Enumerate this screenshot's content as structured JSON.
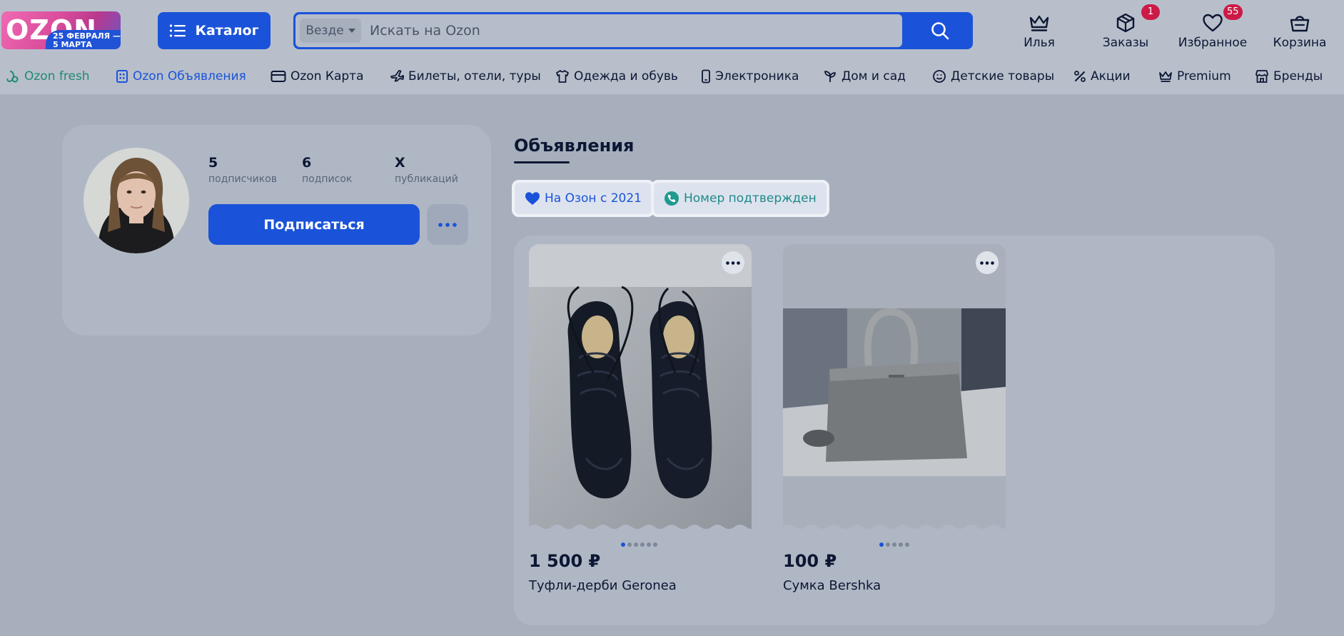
{
  "logo": {
    "word": "OZON",
    "promo": "25 ФЕВРАЛЯ — 5 МАРТА"
  },
  "catalog": {
    "label": "Каталог"
  },
  "search": {
    "scope": "Везде",
    "placeholder": "Искать на Ozon"
  },
  "header_actions": [
    {
      "label": "Илья",
      "icon": "crown-icon"
    },
    {
      "label": "Заказы",
      "icon": "box-icon",
      "badge": "1"
    },
    {
      "label": "Избранное",
      "icon": "heart-icon",
      "badge": "55"
    },
    {
      "label": "Корзина",
      "icon": "basket-icon"
    }
  ],
  "nav": [
    {
      "label": "Ozon fresh",
      "color": "#1f8a70"
    },
    {
      "label": "Ozon Объявления",
      "color": "#1a53d9"
    },
    {
      "label": "Ozon Карта"
    },
    {
      "label": "Билеты, отели, туры"
    },
    {
      "label": "Одежда и обувь"
    },
    {
      "label": "Электроника"
    },
    {
      "label": "Дом и сад"
    },
    {
      "label": "Детские товары"
    },
    {
      "label": "Акции"
    },
    {
      "label": "Premium"
    },
    {
      "label": "Бренды"
    }
  ],
  "profile": {
    "stats": [
      {
        "value": "5",
        "caption": "подписчиков"
      },
      {
        "value": "6",
        "caption": "подписок"
      },
      {
        "value": "X",
        "caption": "публикаций"
      }
    ],
    "subscribe_label": "Подписаться"
  },
  "listings": {
    "title": "Объявления",
    "chips": [
      {
        "label": "На Озон с 2021",
        "color": "#1a53d9"
      },
      {
        "label": "Номер подтвержден",
        "color": "#1f8a8a"
      }
    ],
    "items": [
      {
        "price": "1 500 ₽",
        "name": "Туфли-дерби Geronea",
        "photos": 6,
        "active_photo": 0
      },
      {
        "price": "100 ₽",
        "name": "Сумка Bershka",
        "photos": 5,
        "active_photo": 0
      }
    ]
  },
  "colors": {
    "accent": "#1a53d9",
    "badge": "#cc1a46",
    "text": "#0c1733"
  }
}
